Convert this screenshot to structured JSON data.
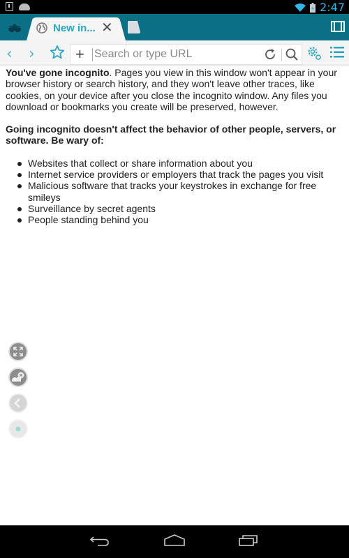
{
  "status_bar": {
    "time": "2:47",
    "icons": [
      "download-notification-icon",
      "android-notification-icon",
      "wifi-icon",
      "battery-icon"
    ]
  },
  "tab_bar": {
    "incognito_icon": "incognito-mask-icon",
    "tabs": [
      {
        "title": "New in...",
        "icon": "globe-icon",
        "close_label": "✕",
        "active": true
      }
    ],
    "new_tab_icon": "new-tab-icon",
    "tab_switcher_icon": "tab-switcher-icon"
  },
  "toolbar": {
    "back_label": "‹",
    "forward_label": "›",
    "bookmark_icon": "star-icon",
    "url": {
      "add_label": "+",
      "placeholder": "Search or type URL",
      "value": ""
    },
    "reload_icon": "reload-icon",
    "search_icon": "search-icon",
    "settings_icon": "gear-icon",
    "menu_icon": "menu-icon"
  },
  "page": {
    "intro_bold": "You've gone incognito",
    "intro_rest": ". Pages you view in this window won't appear in your browser history or search history, and they won't leave other traces, like cookies, on your device after you close the incognito window. Any files you download or bookmarks you create will be preserved, however.",
    "warning": "Going incognito doesn't affect the behavior of other people, servers, or software. Be wary of:",
    "list": [
      "Websites that collect or share information about you",
      "Internet service providers or employers that track the pages you visit",
      "Malicious software that tracks your keystrokes in exchange for free smileys",
      "Surveillance by secret agents",
      "People standing behind you"
    ]
  },
  "side_controls": [
    "fullscreen-icon",
    "no-image-icon",
    "back-icon",
    "dot-icon"
  ],
  "nav_bar": [
    "back-nav-icon",
    "home-nav-icon",
    "recents-nav-icon"
  ],
  "colors": {
    "tab_bar": "#0b6f86",
    "accent": "#2aa5c2",
    "status_time": "#33b5e5"
  }
}
